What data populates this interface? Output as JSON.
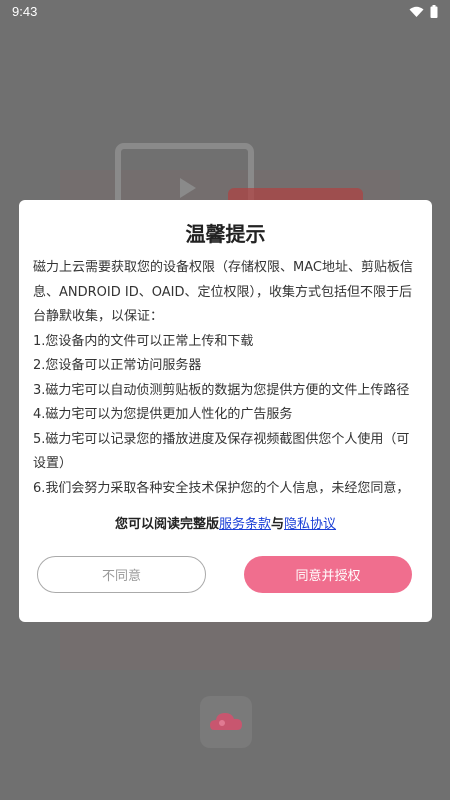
{
  "status_bar": {
    "time": "9:43",
    "icons": [
      "wifi-icon",
      "battery-icon"
    ]
  },
  "colors": {
    "accent": "#f06e8e",
    "link": "#1a3fd6",
    "overlay": "#707070"
  },
  "dialog": {
    "title": "温馨提示",
    "intro": "磁力上云需要获取您的设备权限（存储权限、MAC地址、剪贴板信息、ANDROID ID、OAID、定位权限），收集方式包括但不限于后台静默收集，以保证：",
    "items": [
      "1.您设备内的文件可以正常上传和下载",
      "2.您设备可以正常访问服务器",
      "3.磁力宅可以自动侦测剪贴板的数据为您提供方便的文件上传路径",
      "4.磁力宅可以为您提供更加人性化的广告服务",
      "5.磁力宅可以记录您的播放进度及保存视频截图供您个人使用（可设置）",
      "6.我们会努力采取各种安全技术保护您的个人信息，未经您同意，"
    ],
    "read_prefix": "您可以阅读完整版",
    "terms_link": "服务条款",
    "read_and": "与",
    "privacy_link": "隐私协议",
    "decline_label": "不同意",
    "agree_label": "同意并授权"
  },
  "bottom_logo_icon": "cloud-logo-icon"
}
